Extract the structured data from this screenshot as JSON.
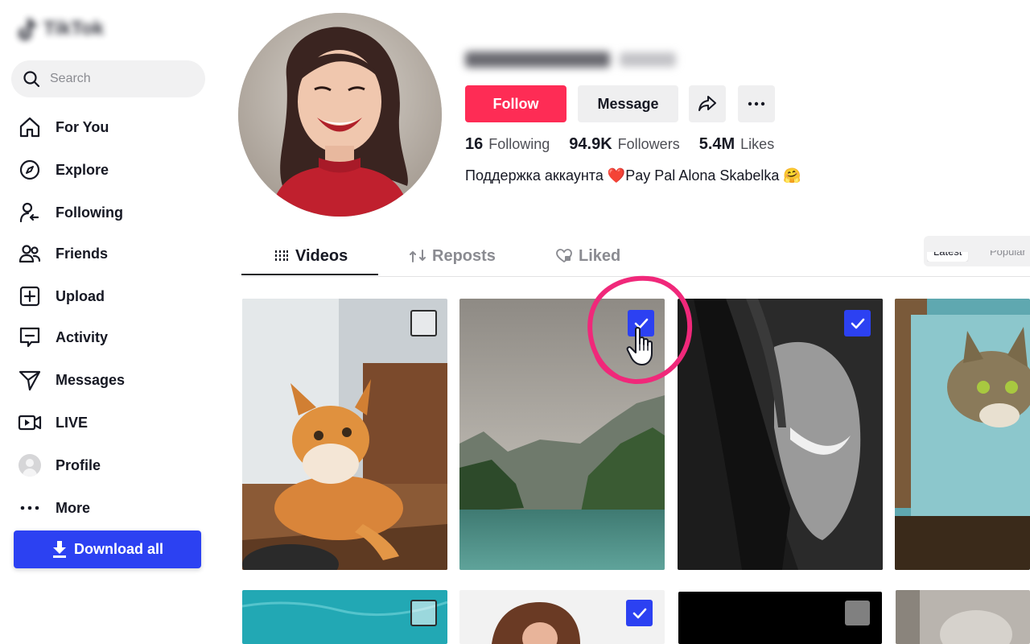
{
  "app": {
    "logo_text": "TikTok"
  },
  "search": {
    "placeholder": "Search"
  },
  "nav": [
    {
      "label": "For You",
      "icon": "home-icon"
    },
    {
      "label": "Explore",
      "icon": "compass-icon"
    },
    {
      "label": "Following",
      "icon": "following-icon"
    },
    {
      "label": "Friends",
      "icon": "friends-icon"
    },
    {
      "label": "Upload",
      "icon": "upload-icon"
    },
    {
      "label": "Activity",
      "icon": "activity-icon"
    },
    {
      "label": "Messages",
      "icon": "messages-icon"
    },
    {
      "label": "LIVE",
      "icon": "live-icon"
    },
    {
      "label": "Profile",
      "icon": "avatar"
    },
    {
      "label": "More",
      "icon": "more-icon"
    }
  ],
  "download": {
    "label": "Download all"
  },
  "profile": {
    "follow_label": "Follow",
    "message_label": "Message",
    "following_count": "16",
    "following_label": "Following",
    "followers_count": "94.9K",
    "followers_label": "Followers",
    "likes_count": "5.4M",
    "likes_label": "Likes",
    "bio": "Поддержка аккаунта ❤️Pay Pal Alona Skabelka 🤗"
  },
  "tabs": {
    "videos": "Videos",
    "reposts": "Reposts",
    "liked": "Liked"
  },
  "sort": {
    "latest": "Latest",
    "popular": "Popular"
  },
  "videos": [
    {
      "subject": "ginger cat",
      "selected": false
    },
    {
      "subject": "mountain lake",
      "selected": true
    },
    {
      "subject": "laughing woman",
      "selected": true
    },
    {
      "subject": "tabby cat",
      "selected": false
    },
    {
      "subject": "turquoise water",
      "selected": false
    },
    {
      "subject": "woman portrait",
      "selected": true
    },
    {
      "subject": "black frame",
      "selected": false
    },
    {
      "subject": "grey cat",
      "selected": false
    }
  ],
  "colors": {
    "accent": "#fe2c55",
    "download": "#2c41f2",
    "highlight": "#f0287a",
    "text": "#161823"
  }
}
